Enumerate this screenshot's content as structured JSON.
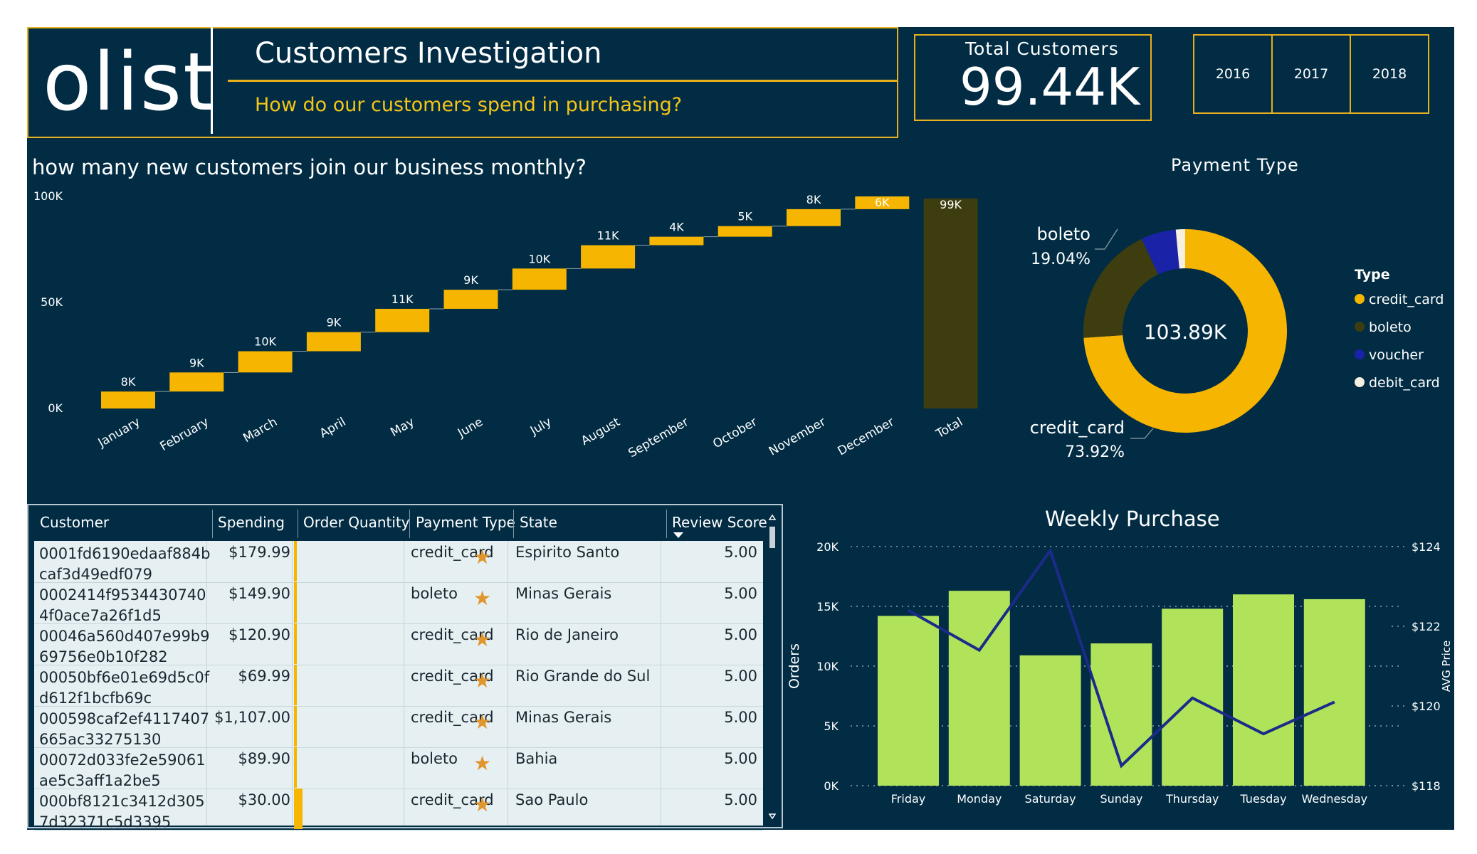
{
  "header": {
    "logo": "olist",
    "title": "Customers Investigation",
    "subtitle": "How do our customers spend in purchasing?"
  },
  "kpi": {
    "label": "Total Customers",
    "value": "99.44K"
  },
  "years": [
    "2016",
    "2017",
    "2018"
  ],
  "colors": {
    "background": "#012c44",
    "accent": "#f5b500",
    "total_bar": "#3d3d10",
    "weekly_bar": "#b1e35a",
    "weekly_line": "#1c2a8a"
  },
  "chart_data": [
    {
      "type": "waterfall",
      "title": "how many new customers join our business monthly?",
      "categories": [
        "January",
        "February",
        "March",
        "April",
        "May",
        "June",
        "July",
        "August",
        "September",
        "October",
        "November",
        "December",
        "Total"
      ],
      "values": [
        8,
        9,
        10,
        9,
        11,
        9,
        10,
        11,
        4,
        5,
        8,
        6,
        99
      ],
      "data_labels": [
        "8K",
        "9K",
        "10K",
        "9K",
        "11K",
        "9K",
        "10K",
        "11K",
        "4K",
        "5K",
        "8K",
        "6K",
        "99K"
      ],
      "y_ticks": [
        "100K",
        "50K",
        "0K"
      ],
      "ylim": [
        0,
        100
      ],
      "units": "thousands"
    },
    {
      "type": "pie",
      "title": "Payment Type",
      "center_label": "103.89K",
      "legend_title": "Type",
      "slices": [
        {
          "name": "credit_card",
          "value": 73.92,
          "label": "73.92%",
          "color": "#f5b500"
        },
        {
          "name": "boleto",
          "value": 19.04,
          "label": "19.04%",
          "color": "#3d3d10"
        },
        {
          "name": "voucher",
          "value": 5.56,
          "color": "#1a23a8"
        },
        {
          "name": "debit_card",
          "value": 1.48,
          "color": "#f5f0e0"
        }
      ]
    },
    {
      "type": "bar",
      "title": "Weekly Purchase",
      "categories": [
        "Friday",
        "Monday",
        "Saturday",
        "Sunday",
        "Thursday",
        "Tuesday",
        "Wednesday"
      ],
      "series": [
        {
          "name": "Orders",
          "values": [
            14200,
            16300,
            10900,
            11900,
            14800,
            16000,
            15600
          ]
        },
        {
          "name": "AVG Price",
          "values": [
            122.4,
            121.4,
            123.9,
            118.5,
            120.2,
            119.3,
            120.1
          ]
        }
      ],
      "ylabel": "Orders",
      "y2label": "AVG Price",
      "ylim": [
        0,
        20000
      ],
      "y2lim": [
        118,
        124
      ],
      "y_ticks": [
        "20K",
        "15K",
        "10K",
        "5K",
        "0K"
      ],
      "y2_ticks": [
        "$124",
        "$122",
        "$120",
        "$118"
      ]
    }
  ],
  "table": {
    "columns": [
      "Customer",
      "Spending",
      "Order Quantity",
      "Payment Type",
      "State",
      "Review Score"
    ],
    "rows": [
      {
        "customer": "0001fd6190edaaf884b caf3d49edf079",
        "spending": "$179.99",
        "qty": 1,
        "payment": "credit_card",
        "state": "Espirito Santo",
        "score": "5.00"
      },
      {
        "customer": "0002414f9534430740 4f0ace7a26f1d5",
        "spending": "$149.90",
        "qty": 1,
        "payment": "boleto",
        "state": "Minas Gerais",
        "score": "5.00"
      },
      {
        "customer": "00046a560d407e99b9 69756e0b10f282",
        "spending": "$120.90",
        "qty": 1,
        "payment": "credit_card",
        "state": "Rio de Janeiro",
        "score": "5.00"
      },
      {
        "customer": "00050bf6e01e69d5c0f d612f1bcfb69c",
        "spending": "$69.99",
        "qty": 1,
        "payment": "credit_card",
        "state": "Rio Grande do Sul",
        "score": "5.00"
      },
      {
        "customer": "000598caf2ef4117407 665ac33275130",
        "spending": "$1,107.00",
        "qty": 1,
        "payment": "credit_card",
        "state": "Minas Gerais",
        "score": "5.00"
      },
      {
        "customer": "00072d033fe2e59061 ae5c3aff1a2be5",
        "spending": "$89.90",
        "qty": 1,
        "payment": "boleto",
        "state": "Bahia",
        "score": "5.00"
      },
      {
        "customer": "000bf8121c3412d305 7d32371c5d3395",
        "spending": "$30.00",
        "qty": 3,
        "payment": "credit_card",
        "state": "Sao Paulo",
        "score": "5.00"
      }
    ]
  }
}
